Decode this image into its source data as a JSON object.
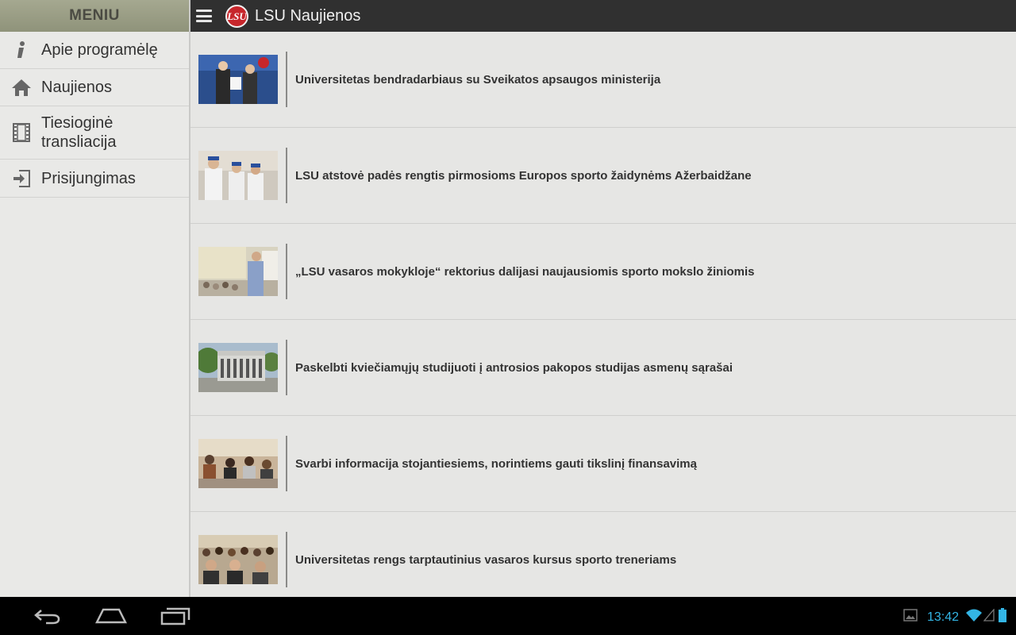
{
  "sidebar": {
    "header": "MENIU",
    "items": [
      {
        "label": "Apie programėlę",
        "icon": "info-icon"
      },
      {
        "label": "Naujienos",
        "icon": "home-icon"
      },
      {
        "label": "Tiesioginė\ntransliacija",
        "icon": "film-icon"
      },
      {
        "label": "Prisijungimas",
        "icon": "login-icon"
      }
    ]
  },
  "topbar": {
    "title": "LSU Naujienos",
    "logo_text": "LSU"
  },
  "news": [
    {
      "title": "Universitetas bendradarbiaus su Sveikatos apsaugos ministerija"
    },
    {
      "title": "LSU atstovė padės rengtis pirmosioms Europos sporto žaidynėms Ažerbaidžane"
    },
    {
      "title": "„LSU vasaros mokykloje“ rektorius dalijasi naujausiomis sporto mokslo žiniomis"
    },
    {
      "title": "Paskelbti kviečiamųjų studijuoti į antrosios pakopos studijas asmenų sąrašai"
    },
    {
      "title": "Svarbi informacija stojantiesiems, norintiems gauti tikslinį finansavimą"
    },
    {
      "title": "Universitetas rengs tarptautinius vasaros kursus sporto treneriams"
    }
  ],
  "statusbar": {
    "time": "13:42"
  },
  "colors": {
    "accent": "#33b5e5",
    "logo": "#c7262b",
    "topbar": "#303030"
  }
}
